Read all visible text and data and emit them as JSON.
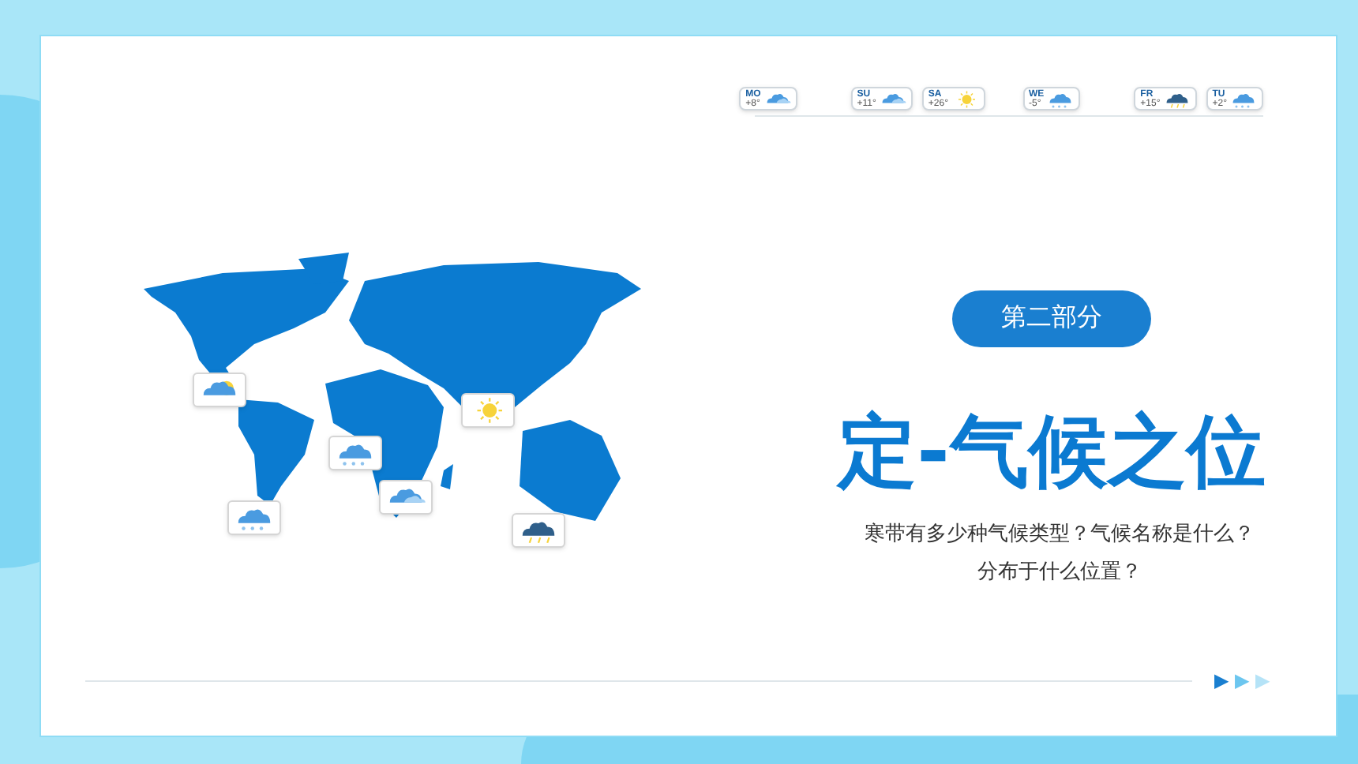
{
  "forecast": [
    {
      "day": "MO",
      "temp": "+8°",
      "kind": "cloud"
    },
    {
      "day": "SU",
      "temp": "+11°",
      "kind": "cloud"
    },
    {
      "day": "SA",
      "temp": "+26°",
      "kind": "sun"
    },
    {
      "day": "WE",
      "temp": "-5°",
      "kind": "snow"
    },
    {
      "day": "FR",
      "temp": "+15°",
      "kind": "storm"
    },
    {
      "day": "TU",
      "temp": "+2°",
      "kind": "snow"
    }
  ],
  "map": {
    "markers": [
      {
        "kind": "sun-cloud"
      },
      {
        "kind": "snow"
      },
      {
        "kind": "snow"
      },
      {
        "kind": "cloud"
      },
      {
        "kind": "sun"
      },
      {
        "kind": "storm"
      }
    ]
  },
  "section_badge": "第二部分",
  "title": "定-气候之位",
  "subtitle": [
    "寒带有多少种气候类型？气候名称是什么？",
    "分布于什么位置？"
  ],
  "arrows": [
    {
      "text": "▶",
      "color": "#1a7fd0"
    },
    {
      "text": "▶",
      "color": "#6cc6ef"
    },
    {
      "text": "▶",
      "color": "#b5e3f7"
    }
  ]
}
